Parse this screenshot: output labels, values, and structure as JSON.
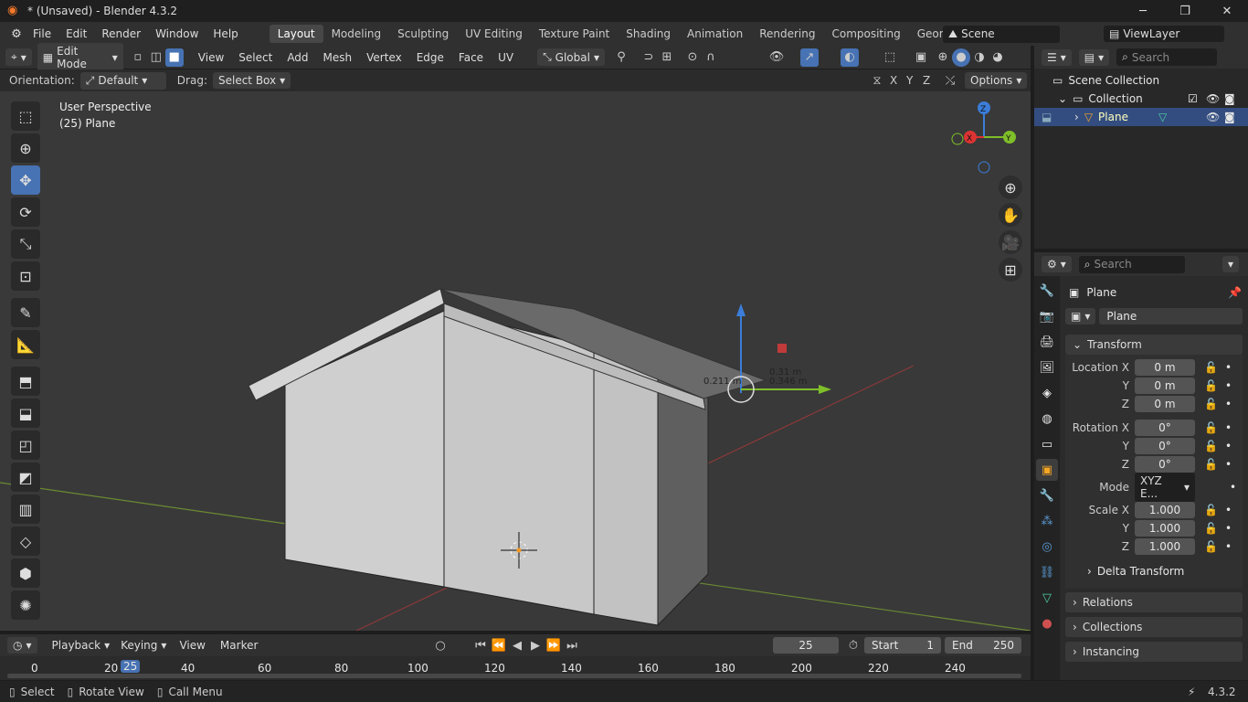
{
  "window": {
    "title": "* (Unsaved) - Blender 4.3.2",
    "minimize": "─",
    "maximize": "❐",
    "close": "✕"
  },
  "menu": [
    "File",
    "Edit",
    "Render",
    "Window",
    "Help"
  ],
  "workspaces": [
    "Layout",
    "Modeling",
    "Sculpting",
    "UV Editing",
    "Texture Paint",
    "Shading",
    "Animation",
    "Rendering",
    "Compositing",
    "Geometry Node"
  ],
  "scene": "Scene",
  "viewlayer": "ViewLayer",
  "header3d": {
    "mode": "Edit Mode",
    "menus": [
      "View",
      "Select",
      "Add",
      "Mesh",
      "Vertex",
      "Edge",
      "Face",
      "UV"
    ],
    "transform": "Global"
  },
  "toolsettings": {
    "orientation_label": "Orientation:",
    "orientation": "Default",
    "drag_label": "Drag:",
    "drag": "Select Box",
    "axes": [
      "X",
      "Y",
      "Z"
    ],
    "options": "Options"
  },
  "viewport": {
    "perspective": "User Perspective",
    "object": "(25) Plane",
    "dims": [
      "0.211 m",
      "0.346 m",
      "0.31 m"
    ],
    "gizmo": {
      "x": "X",
      "y": "Y",
      "z": "Z"
    }
  },
  "outliner": {
    "search": "Search",
    "root": "Scene Collection",
    "collection": "Collection",
    "object": "Plane"
  },
  "props": {
    "search": "Search",
    "object_name": "Plane",
    "data_name": "Plane",
    "transform": "Transform",
    "location": {
      "label": "Location X",
      "x": "0 m",
      "y": "0 m",
      "z": "0 m"
    },
    "rotation": {
      "label": "Rotation X",
      "x": "0°",
      "y": "0°",
      "z": "0°"
    },
    "mode_label": "Mode",
    "mode": "XYZ E...",
    "scale": {
      "label": "Scale X",
      "x": "1.000",
      "y": "1.000",
      "z": "1.000"
    },
    "axis_y": "Y",
    "axis_z": "Z",
    "panels": [
      "Delta Transform",
      "Relations",
      "Collections",
      "Instancing"
    ]
  },
  "timeline": {
    "menus": [
      "Playback",
      "Keying",
      "View",
      "Marker"
    ],
    "current": "25",
    "start_label": "Start",
    "start": "1",
    "end_label": "End",
    "end": "250",
    "ticks": [
      "0",
      "20",
      "40",
      "60",
      "80",
      "100",
      "120",
      "140",
      "160",
      "180",
      "200",
      "220",
      "240"
    ]
  },
  "status": {
    "select": "Select",
    "rotate": "Rotate View",
    "call": "Call Menu",
    "version": "4.3.2"
  }
}
